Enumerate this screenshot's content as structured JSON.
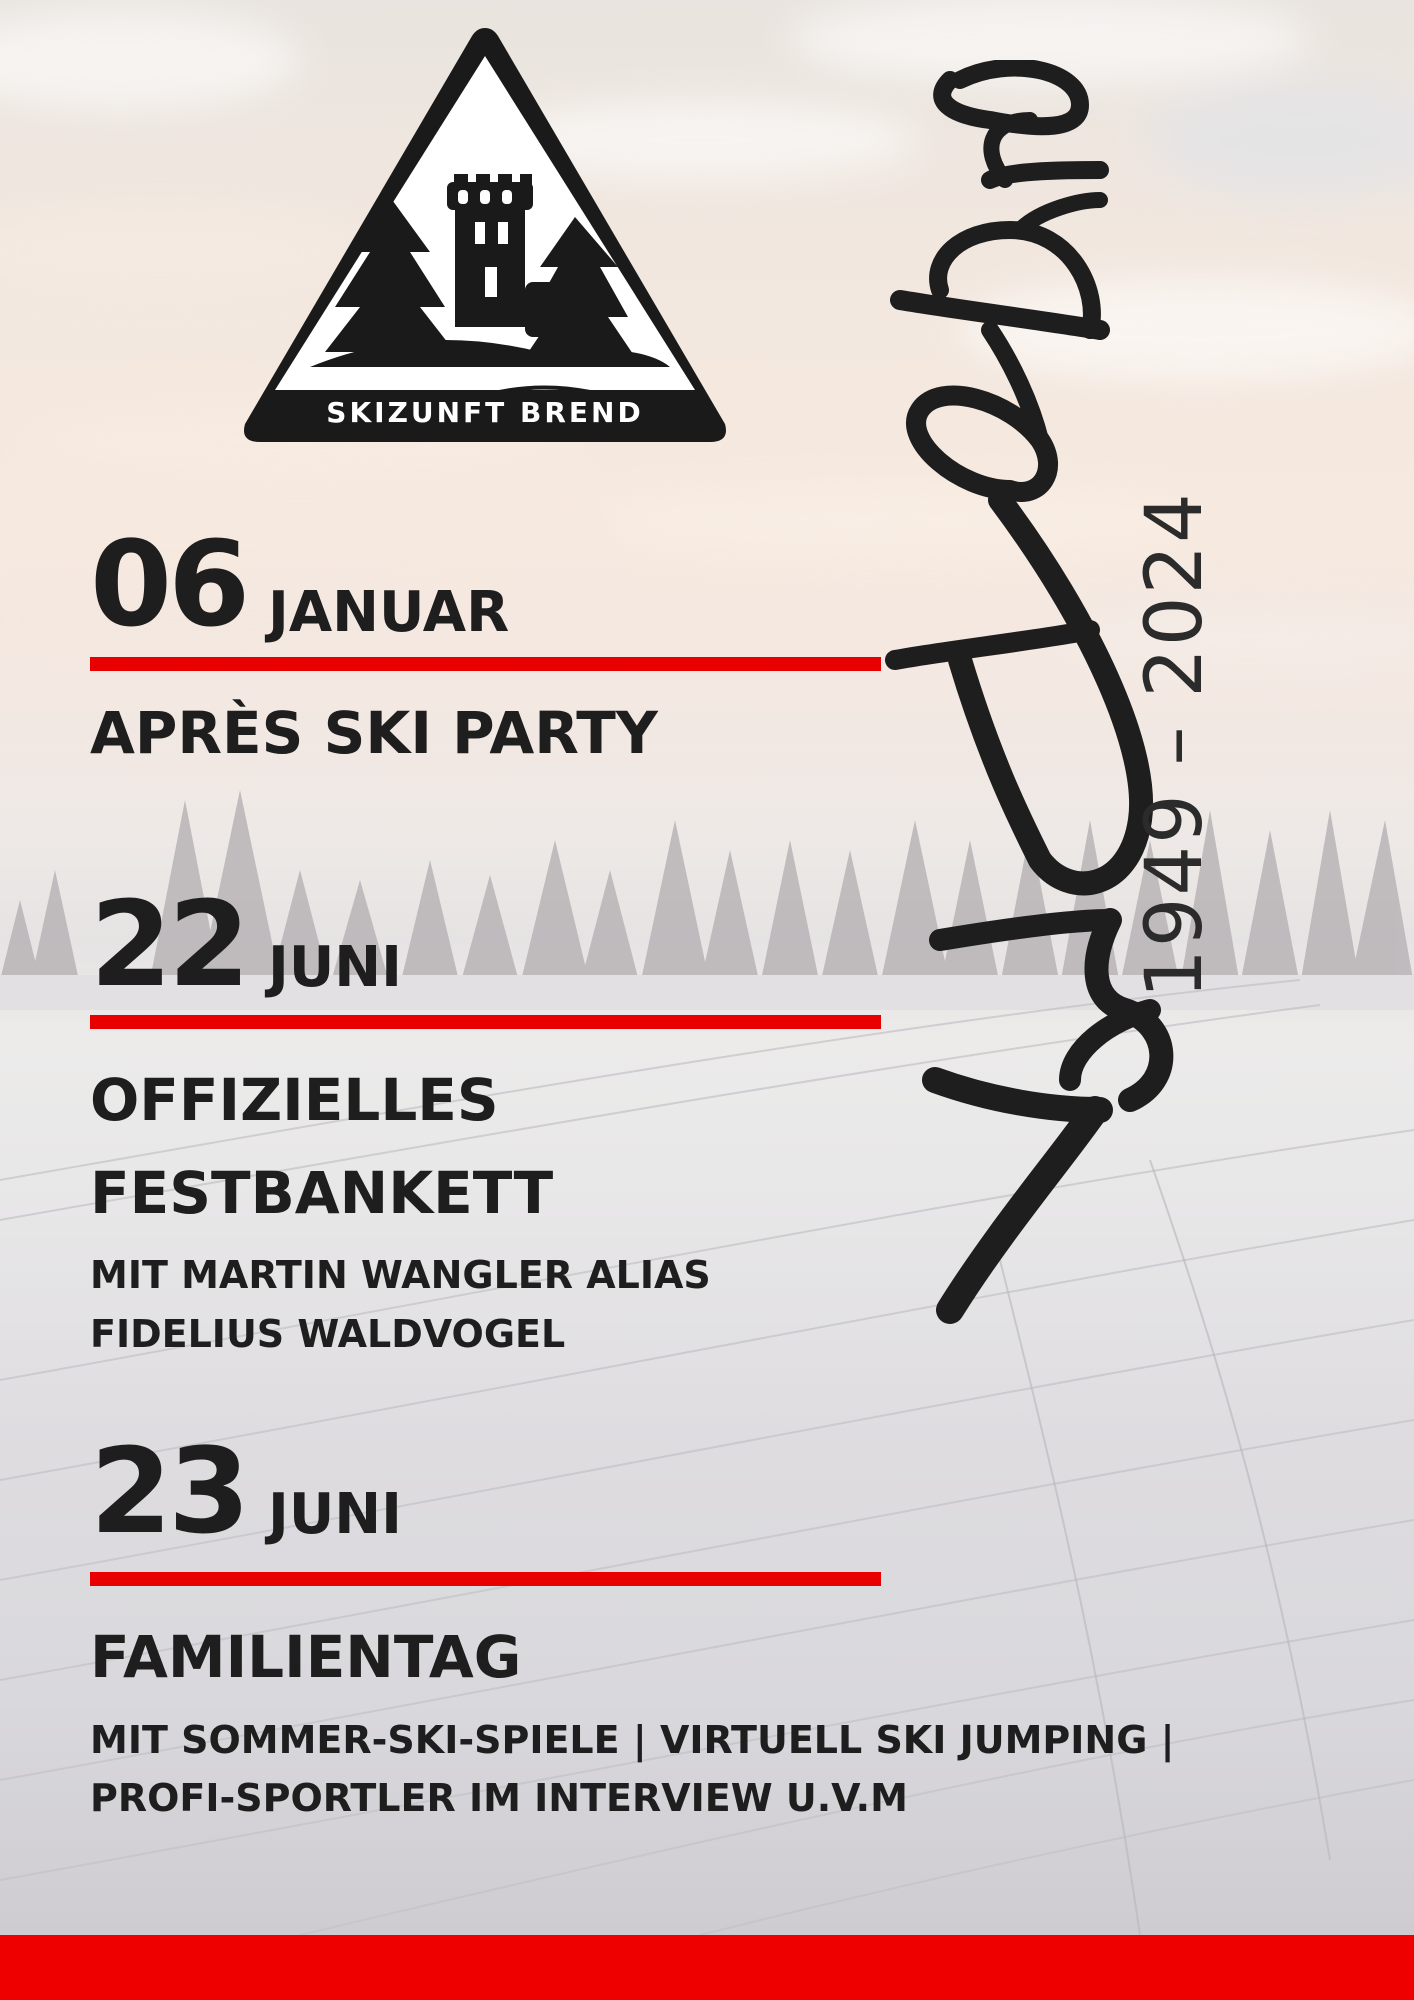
{
  "logo": {
    "club_name": "SKIZUNFT BREND"
  },
  "anniversary": {
    "script_text": "75 Jahre",
    "years": "1949 – 2024"
  },
  "events": [
    {
      "day": "06",
      "month": "JANUAR",
      "title": "APRÈS SKI PARTY"
    },
    {
      "day": "22",
      "month": "JUNI",
      "title_line1": "OFFIZIELLES",
      "title_line2": "FESTBANKETT",
      "subtitle_line1": "MIT  MARTIN WANGLER ALIAS",
      "subtitle_line2": "FIDELIUS WALDVOGEL"
    },
    {
      "day": "23",
      "month": "JUNI",
      "title": "FAMILIENTAG",
      "subtitle_line1": "MIT SOMMER-SKI-SPIELE | VIRTUELL SKI JUMPING |",
      "subtitle_line2": "PROFI-SPORTLER IM INTERVIEW  U.V.M"
    }
  ],
  "colors": {
    "accent": "#e80000",
    "text": "#1e1e1e",
    "logo_dark": "#1a1a1a"
  }
}
